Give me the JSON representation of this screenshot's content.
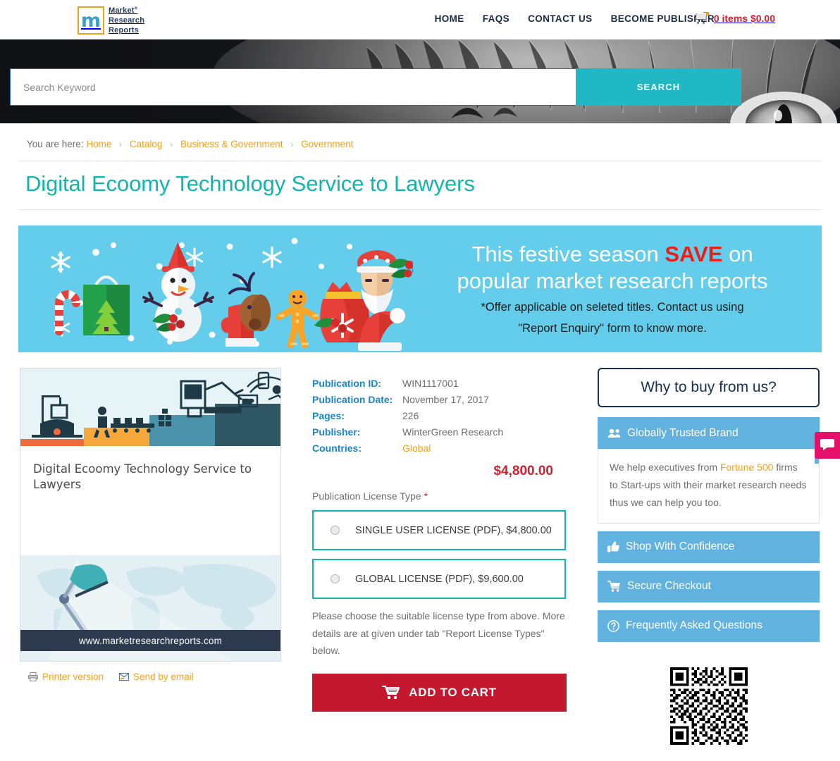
{
  "header": {
    "logo": {
      "mark": "m",
      "line1": "Market",
      "line2": "Research",
      "line3": "Reports",
      "trademark": "®"
    },
    "nav": [
      {
        "label": "HOME",
        "name": "nav-home"
      },
      {
        "label": "FAQS",
        "name": "nav-faqs"
      },
      {
        "label": "CONTACT US",
        "name": "nav-contact-us"
      },
      {
        "label": "BECOME PUBLISHER",
        "name": "nav-become-publisher"
      }
    ],
    "cart": {
      "icon": "shopping-cart-icon",
      "label": "0 items $0.00",
      "items": 0,
      "total": "$0.00"
    }
  },
  "search": {
    "placeholder": "Search Keyword",
    "value": "",
    "button_label": "SEARCH",
    "button_color": "#1fb8c4"
  },
  "breadcrumb": {
    "lead": "You are here:",
    "separator": "›",
    "items": [
      "Home",
      "Catalog",
      "Business & Government",
      "Government"
    ]
  },
  "page": {
    "title": "Digital Ecoomy Technology Service to Lawyers",
    "title_color": "#12b5ad"
  },
  "banner": {
    "background": "#63cdeb",
    "line1_prefix": "This festive season ",
    "line1_highlight": "SAVE",
    "line1_suffix": " on",
    "line2": "popular market research reports",
    "line3": "*Offer applicable on seleted titles. Contact us using",
    "line4": "\"Report Enquiry\" form to know more.",
    "highlight_color": "#e8201a",
    "art_items": [
      "candy-cane",
      "gift-bag",
      "snowman",
      "holly",
      "mitten",
      "reindeer",
      "gingerbread-man",
      "santa-sack",
      "santa-face",
      "santa-hat",
      "snowflakes"
    ]
  },
  "product": {
    "cover_title": "Digital Ecoomy Technology Service to Lawyers",
    "cover_url": "www.marketresearchreports.com",
    "cover_top_art": "industry-evolution-graphic",
    "cover_bottom_art": "desk-lamp-world-map-graphic",
    "share": [
      {
        "label": "Printer version",
        "icon": "printer-icon",
        "name": "printer-version-link"
      },
      {
        "label": "Send by email",
        "icon": "envelope-icon",
        "name": "send-by-email-link"
      }
    ]
  },
  "details": {
    "rows": [
      {
        "label": "Publication ID:",
        "value": "WIN1117001",
        "accent": false
      },
      {
        "label": "Publication Date:",
        "value": "November 17, 2017",
        "accent": false
      },
      {
        "label": "Pages:",
        "value": "226",
        "accent": false
      },
      {
        "label": "Publisher:",
        "value": "WinterGreen Research",
        "accent": false
      },
      {
        "label": "Countries:",
        "value": "Global",
        "accent": true
      }
    ],
    "price": "$4,800.00",
    "price_color": "#cf2131"
  },
  "license": {
    "label": "Publication License Type",
    "required_mark": "*",
    "options": [
      {
        "label": "SINGLE USER LICENSE (PDF), $4,800.00",
        "selected": false,
        "name": "license-option-single-user"
      },
      {
        "label": "GLOBAL LICENSE (PDF), $9,600.00",
        "selected": false,
        "name": "license-option-global"
      }
    ],
    "note": "Please choose the suitable license type from above. More details are at given under tab \"Report License Types\" below.",
    "add_to_cart_label": "ADD TO CART",
    "add_to_cart_color": "#c4182e",
    "cart_icon": "cart-icon"
  },
  "sidebar": {
    "heading": "Why to buy from us?",
    "accordion": [
      {
        "title": "Globally Trusted Brand",
        "icon": "users-group-icon",
        "open": true,
        "body_before": "We help executives from ",
        "body_highlight": "Fortune 500",
        "body_after": " firms to Start-ups with their market research needs thus we can help you too.",
        "name": "accordion-globally-trusted-brand"
      },
      {
        "title": "Shop With Confidence",
        "icon": "thumbs-up-icon",
        "open": false,
        "name": "accordion-shop-with-confidence"
      },
      {
        "title": "Secure Checkout",
        "icon": "shopping-cart-icon",
        "open": false,
        "name": "accordion-secure-checkout"
      },
      {
        "title": "Frequently Asked Questions",
        "icon": "question-circle-icon",
        "open": false,
        "name": "accordion-faq"
      }
    ],
    "header_color": "#62b2e0",
    "qr_alt": "qr-code"
  },
  "chat_widget": {
    "icon": "chat-bubble-icon",
    "color": "#e5106a"
  }
}
